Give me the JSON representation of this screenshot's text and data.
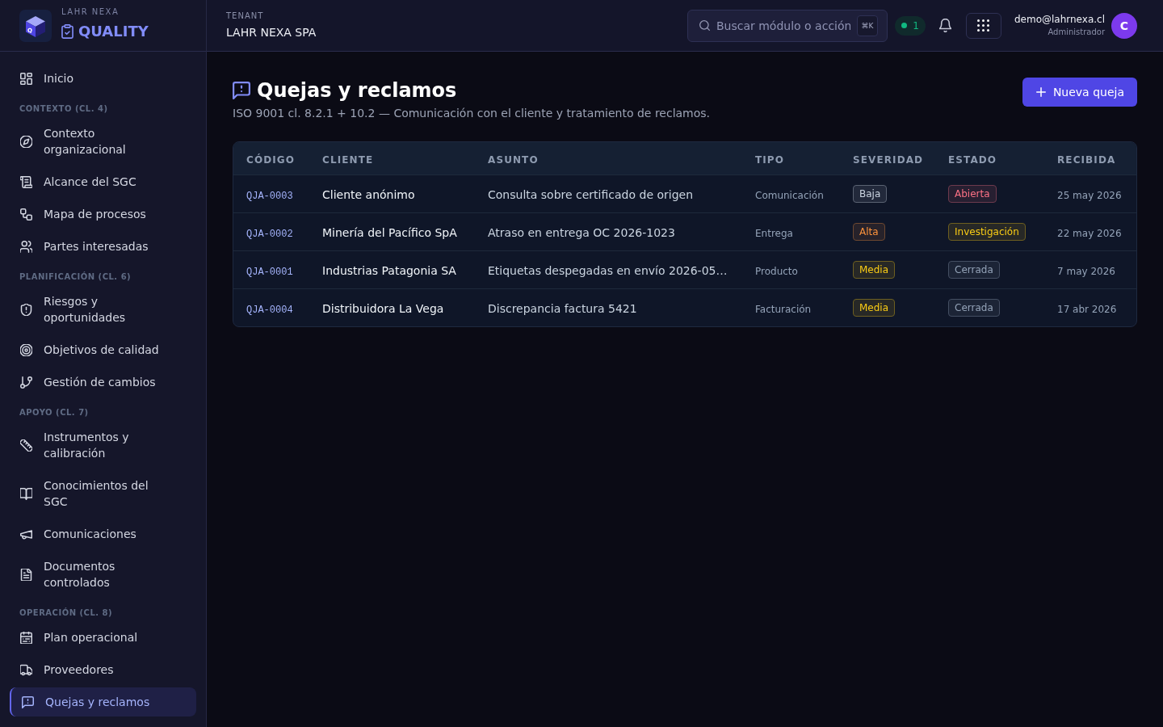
{
  "brand": {
    "logo_letter": "Q",
    "company": "LAHR NEXA",
    "product": "QUALITY"
  },
  "tenant": {
    "label": "TENANT",
    "name": "LAHR NEXA SPA"
  },
  "search": {
    "placeholder": "Buscar módulo o acción",
    "shortcut": "⌘K"
  },
  "status_pill": {
    "count": "1"
  },
  "user": {
    "email": "demo@lahrnexa.cl",
    "role": "Administrador",
    "initial": "C"
  },
  "sidebar": {
    "sections": [
      {
        "items": [
          {
            "label": "Inicio",
            "selected": false
          }
        ]
      },
      {
        "title": "CONTEXTO (CL. 4)",
        "items": [
          {
            "label": "Contexto organizacional",
            "selected": false
          },
          {
            "label": "Alcance del SGC",
            "selected": false
          },
          {
            "label": "Mapa de procesos",
            "selected": false
          },
          {
            "label": "Partes interesadas",
            "selected": false
          }
        ]
      },
      {
        "title": "PLANIFICACIÓN (CL. 6)",
        "items": [
          {
            "label": "Riesgos y oportunidades",
            "selected": false
          },
          {
            "label": "Objetivos de calidad",
            "selected": false
          },
          {
            "label": "Gestión de cambios",
            "selected": false
          }
        ]
      },
      {
        "title": "APOYO (CL. 7)",
        "items": [
          {
            "label": "Instrumentos y calibración",
            "selected": false
          },
          {
            "label": "Conocimientos del SGC",
            "selected": false
          },
          {
            "label": "Comunicaciones",
            "selected": false
          },
          {
            "label": "Documentos controlados",
            "selected": false
          }
        ]
      },
      {
        "title": "OPERACIÓN (CL. 8)",
        "items": [
          {
            "label": "Plan operacional",
            "selected": false
          },
          {
            "label": "Proveedores",
            "selected": false
          },
          {
            "label": "Quejas y reclamos",
            "selected": true
          }
        ]
      }
    ]
  },
  "page": {
    "title": "Quejas y reclamos",
    "subtitle": "ISO 9001 cl. 8.2.1 + 10.2 — Comunicación con el cliente y tratamiento de reclamos.",
    "primary_button": "Nueva queja"
  },
  "table": {
    "columns": [
      "CÓDIGO",
      "CLIENTE",
      "ASUNTO",
      "TIPO",
      "SEVERIDAD",
      "ESTADO",
      "RECIBIDA"
    ],
    "rows": [
      {
        "code": "QJA-0003",
        "client": "Cliente anónimo",
        "subject": "Consulta sobre certificado de origen",
        "type": "Comunicación",
        "severity": {
          "label": "Baja",
          "color": "#cbd5e1"
        },
        "status": {
          "label": "Abierta",
          "color": "#fb7185"
        },
        "received": "25 may 2026"
      },
      {
        "code": "QJA-0002",
        "client": "Minería del Pacífico SpA",
        "subject": "Atraso en entrega OC 2026-1023",
        "type": "Entrega",
        "severity": {
          "label": "Alta",
          "color": "#fb923c"
        },
        "status": {
          "label": "Investigación",
          "color": "#facc15"
        },
        "received": "22 may 2026"
      },
      {
        "code": "QJA-0001",
        "client": "Industrias Patagonia SA",
        "subject": "Etiquetas despegadas en envío 2026-05…",
        "type": "Producto",
        "severity": {
          "label": "Media",
          "color": "#facc15"
        },
        "status": {
          "label": "Cerrada",
          "color": "#94a3b8"
        },
        "received": "7 may 2026"
      },
      {
        "code": "QJA-0004",
        "client": "Distribuidora La Vega",
        "subject": "Discrepancia factura 5421",
        "type": "Facturación",
        "severity": {
          "label": "Media",
          "color": "#facc15"
        },
        "status": {
          "label": "Cerrada",
          "color": "#94a3b8"
        },
        "received": "17 abr 2026"
      }
    ]
  }
}
